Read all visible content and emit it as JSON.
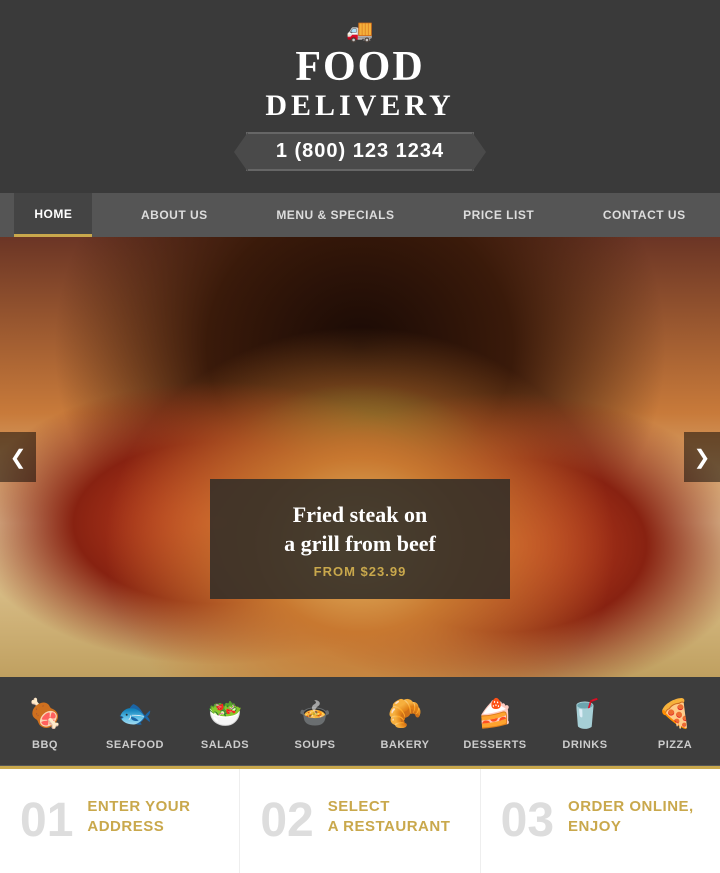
{
  "header": {
    "truck_icon": "🚚",
    "title_line1": "FOOD",
    "title_line2": "DELIVERY",
    "phone": "1 (800) 123 1234"
  },
  "nav": {
    "items": [
      {
        "label": "HOME",
        "active": true
      },
      {
        "label": "ABOUT US",
        "active": false
      },
      {
        "label": "MENU & SPECIALS",
        "active": false
      },
      {
        "label": "PRICE LIST",
        "active": false
      },
      {
        "label": "CONTACT US",
        "active": false
      }
    ]
  },
  "hero": {
    "dish_title": "Fried steak on\na grill from beef",
    "price_label": "FROM $23.99",
    "prev_arrow": "❮",
    "next_arrow": "❯"
  },
  "categories": [
    {
      "label": "BBQ",
      "icon": "🍖"
    },
    {
      "label": "SEAFOOD",
      "icon": "🐟"
    },
    {
      "label": "SALADS",
      "icon": "🥗"
    },
    {
      "label": "SOUPS",
      "icon": "🍲"
    },
    {
      "label": "BAKERY",
      "icon": "🥐"
    },
    {
      "label": "DESSERTS",
      "icon": "🍰"
    },
    {
      "label": "DRINKS",
      "icon": "🥤"
    },
    {
      "label": "PIZZA",
      "icon": "🍕"
    }
  ],
  "steps": [
    {
      "number": "01",
      "title": "ENTER YOUR\nADDRESS"
    },
    {
      "number": "02",
      "title": "SELECT\nA RESTAURANT"
    },
    {
      "number": "03",
      "title": "ORDER ONLINE,\nENJOY"
    }
  ]
}
